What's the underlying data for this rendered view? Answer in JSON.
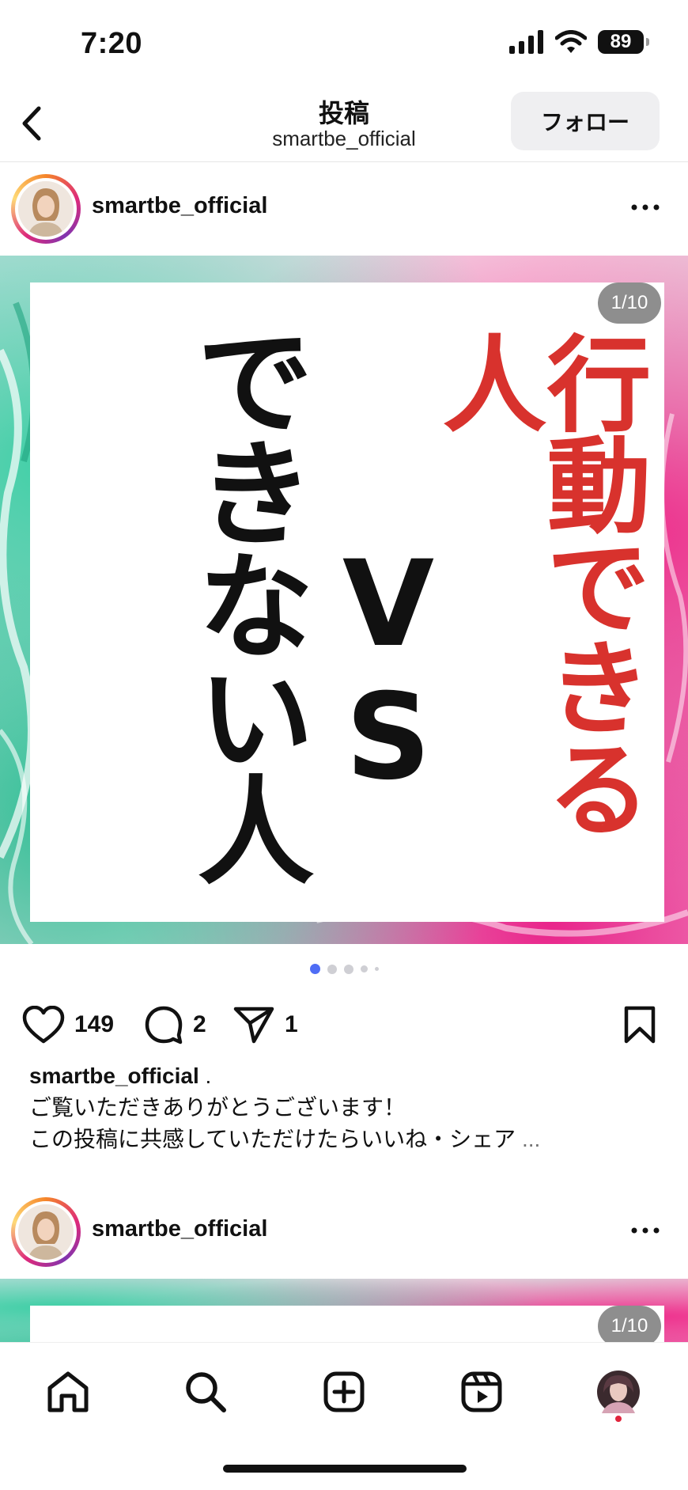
{
  "status_bar": {
    "time": "7:20",
    "battery": "89"
  },
  "header": {
    "title": "投稿",
    "subtitle": "smartbe_official",
    "follow_label": "フォロー"
  },
  "posts": [
    {
      "username": "smartbe_official",
      "slide_counter": "1/10",
      "image_text": {
        "red_column": "行動できる人",
        "vs": "VS",
        "black_column": "できない人"
      },
      "likes": "149",
      "comments": "2",
      "shares": "1",
      "caption": {
        "username": "smartbe_official",
        "suffix": " .",
        "line1": "ご覧いただきありがとうございます！",
        "line2": "この投稿に共感していただけたらいいね・シェア",
        "more": "..."
      }
    },
    {
      "username": "smartbe_official",
      "slide_counter": "1/10"
    }
  ],
  "carousel": {
    "active_index": 0,
    "dot_count": 5
  },
  "bottom_nav": [
    "home-icon",
    "search-icon",
    "create-icon",
    "reels-icon",
    "profile-avatar"
  ],
  "colors": {
    "accent_blue": "#4f6df5",
    "headline_red": "#d8322d",
    "notification_red": "#e0243c"
  }
}
